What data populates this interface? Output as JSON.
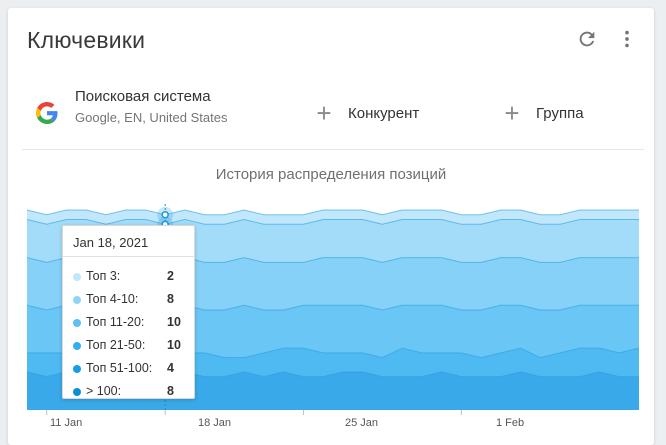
{
  "header": {
    "title": "Ключевики",
    "refresh_icon": "refresh-icon",
    "more_icon": "more-vert-icon"
  },
  "engine": {
    "name": "Поисковая система",
    "details": "Google, EN, United States",
    "icon": "google-logo"
  },
  "actions": {
    "competitor_label": "Конкурент",
    "group_label": "Группа",
    "plus_icon": "plus-icon"
  },
  "chart": {
    "title": "История распределения позиций",
    "x_labels": [
      "11 Jan",
      "18 Jan",
      "25 Jan",
      "1 Feb"
    ],
    "tooltip": {
      "date": "Jan 18, 2021",
      "rows": [
        {
          "label": "Топ 3:",
          "value": "2"
        },
        {
          "label": "Топ 4-10:",
          "value": "8"
        },
        {
          "label": "Топ 11-20:",
          "value": "10"
        },
        {
          "label": "Топ 21-50:",
          "value": "10"
        },
        {
          "label": "Топ 51-100:",
          "value": "4"
        },
        {
          "label": "> 100:",
          "value": "8"
        }
      ]
    }
  },
  "chart_data": {
    "type": "area",
    "stacked": true,
    "x_labels_shown": [
      "11 Jan",
      "18 Jan",
      "25 Jan",
      "1 Feb"
    ],
    "series": [
      {
        "name": "> 100",
        "color": "#3aa9e9",
        "values": [
          8,
          7,
          8,
          8,
          7,
          8,
          7,
          7,
          8,
          7,
          7,
          8,
          7,
          8,
          7,
          7,
          8,
          8,
          7,
          7,
          7,
          8,
          7,
          7,
          7,
          8,
          7,
          7,
          7,
          8,
          7,
          7
        ]
      },
      {
        "name": "Топ 51-100",
        "color": "#4fbaf2",
        "values": [
          4,
          5,
          4,
          4,
          5,
          4,
          5,
          4,
          4,
          5,
          4,
          3,
          5,
          5,
          6,
          5,
          4,
          4,
          4,
          6,
          5,
          4,
          5,
          4,
          5,
          5,
          4,
          5,
          6,
          5,
          5,
          6
        ]
      },
      {
        "name": "Топ 21-50",
        "color": "#6ac7f5",
        "values": [
          10,
          9,
          10,
          11,
          9,
          10,
          10,
          10,
          10,
          9,
          10,
          11,
          9,
          8,
          9,
          10,
          10,
          10,
          10,
          9,
          10,
          10,
          9,
          10,
          10,
          9,
          10,
          9,
          9,
          9,
          10,
          9
        ]
      },
      {
        "name": "Топ 11-20",
        "color": "#86d1f7",
        "values": [
          10,
          10,
          10,
          9,
          10,
          10,
          10,
          10,
          10,
          10,
          10,
          10,
          10,
          10,
          9,
          10,
          10,
          10,
          10,
          10,
          10,
          10,
          10,
          10,
          10,
          10,
          10,
          10,
          10,
          10,
          10,
          10
        ]
      },
      {
        "name": "Топ 4-10",
        "color": "#a3dcf9",
        "values": [
          8,
          8,
          8,
          8,
          8,
          8,
          8,
          8,
          8,
          8,
          8,
          8,
          8,
          8,
          8,
          8,
          8,
          8,
          8,
          8,
          8,
          8,
          8,
          8,
          8,
          8,
          8,
          8,
          8,
          8,
          8,
          8
        ]
      },
      {
        "name": "Топ 3",
        "color": "#c0e7fb",
        "values": [
          2,
          2,
          2,
          2,
          2,
          2,
          2,
          2,
          2,
          2,
          2,
          2,
          2,
          2,
          2,
          2,
          2,
          2,
          2,
          2,
          2,
          2,
          2,
          2,
          2,
          2,
          2,
          2,
          2,
          2,
          2,
          2
        ]
      }
    ],
    "highlight_index": 7,
    "total": 42
  }
}
